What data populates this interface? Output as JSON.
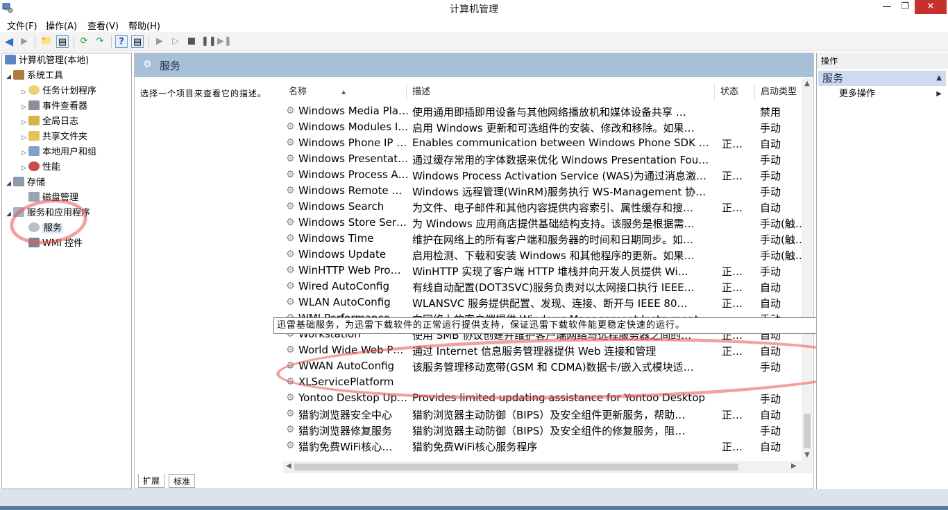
{
  "window": {
    "title": "计算机管理"
  },
  "menu": [
    "文件(F)",
    "操作(A)",
    "查看(V)",
    "帮助(H)"
  ],
  "tree": {
    "root": "计算机管理(本地)",
    "system_tools": "系统工具",
    "task_scheduler": "任务计划程序",
    "event_viewer": "事件查看器",
    "shared_folders_global": "全局日志",
    "shared_folders": "共享文件夹",
    "local_users": "本地用户和组",
    "performance": "性能",
    "storage": "存储",
    "disk_management": "磁盘管理",
    "services_apps": "服务和应用程序",
    "services": "服务",
    "wmi": "WMI 控件"
  },
  "center": {
    "header_title": "服务",
    "description_hint": "选择一个项目来查看它的描述。",
    "columns": {
      "name": "名称",
      "description": "描述",
      "status": "状态",
      "startup": "启动类型"
    },
    "rows": [
      {
        "name": "Windows Media Pla…",
        "desc": "使用通用即插即用设备与其他网络播放机和媒体设备共享 …",
        "status": "",
        "start": "禁用"
      },
      {
        "name": "Windows Modules I…",
        "desc": "启用 Windows 更新和可选组件的安装、修改和移除。如果…",
        "status": "",
        "start": "手动"
      },
      {
        "name": "Windows Phone IP …",
        "desc": "Enables communication between Windows Phone SDK and…",
        "status": "正…",
        "start": "自动"
      },
      {
        "name": "Windows Presentati…",
        "desc": "通过缓存常用的字体数据来优化 Windows Presentation Fou…",
        "status": "",
        "start": "手动"
      },
      {
        "name": "Windows Process A…",
        "desc": "Windows Process Activation Service (WAS)为通过消息激活…",
        "status": "正…",
        "start": "手动"
      },
      {
        "name": "Windows Remote M…",
        "desc": "Windows 远程管理(WinRM)服务执行 WS-Management 协…",
        "status": "",
        "start": "手动"
      },
      {
        "name": "Windows Search",
        "desc": "为文件、电子邮件和其他内容提供内容索引、属性缓存和搜…",
        "status": "正…",
        "start": "自动"
      },
      {
        "name": "Windows Store Ser…",
        "desc": "为 Windows 应用商店提供基础结构支持。该服务是根据需…",
        "status": "",
        "start": "手动(触…"
      },
      {
        "name": "Windows Time",
        "desc": "维护在网络上的所有客户端和服务器的时间和日期同步。如…",
        "status": "",
        "start": "手动(触…"
      },
      {
        "name": "Windows Update",
        "desc": "启用检测、下载和安装 Windows 和其他程序的更新。如果…",
        "status": "",
        "start": "手动(触…"
      },
      {
        "name": "WinHTTP Web Pro…",
        "desc": "WinHTTP 实现了客户端 HTTP 堆栈并向开发人员提供 Wi…",
        "status": "正…",
        "start": "手动"
      },
      {
        "name": "Wired AutoConfig",
        "desc": "有线自动配置(DOT3SVC)服务负责对以太网接口执行 IEEE…",
        "status": "正…",
        "start": "自动"
      },
      {
        "name": "WLAN AutoConfig",
        "desc": "WLANSVC 服务提供配置、发现、连接、断开与 IEEE 80…",
        "status": "正…",
        "start": "自动"
      },
      {
        "name": "WMI Performance …",
        "desc": "向网络上的客户端提供 Windows Management Instrumentat…",
        "status": "",
        "start": "手动"
      },
      {
        "name": "Workstation",
        "desc": "使用 SMB 协议创建并维护客户端网络与远程服务器之间的…",
        "status": "正…",
        "start": "自动"
      },
      {
        "name": "World Wide Web Pu…",
        "desc": "通过 Internet 信息服务管理器提供 Web 连接和管理",
        "status": "正…",
        "start": "自动"
      },
      {
        "name": "WWAN AutoConfig",
        "desc": "该服务管理移动宽带(GSM 和 CDMA)数据卡/嵌入式模块适…",
        "status": "",
        "start": "手动"
      },
      {
        "name": "XLServicePlatform",
        "desc": "",
        "status": "",
        "start": ""
      },
      {
        "name": "Yontoo Desktop Up…",
        "desc": "Provides limited updating assistance for Yontoo Desktop",
        "status": "",
        "start": "手动"
      },
      {
        "name": "猎豹浏览器安全中心",
        "desc": "猎豹浏览器主动防御（BIPS）及安全组件更新服务，帮助…",
        "status": "正…",
        "start": "自动"
      },
      {
        "name": "猎豹浏览器修复服务",
        "desc": "猎豹浏览器主动防御（BIPS）及安全组件的修复服务，阻…",
        "status": "",
        "start": "手动"
      },
      {
        "name": "猎豹免费WiFi核心…",
        "desc": "猎豹免费WiFi核心服务程序",
        "status": "正…",
        "start": "自动"
      }
    ],
    "tooltip": "迅雷基础服务，为迅雷下载软件的正常运行提供支持，保证迅雷下载软件能更稳定快速的运行。",
    "tabs": [
      "扩展",
      "标准"
    ]
  },
  "actions": {
    "header": "操作",
    "section": "服务",
    "more": "更多操作"
  }
}
